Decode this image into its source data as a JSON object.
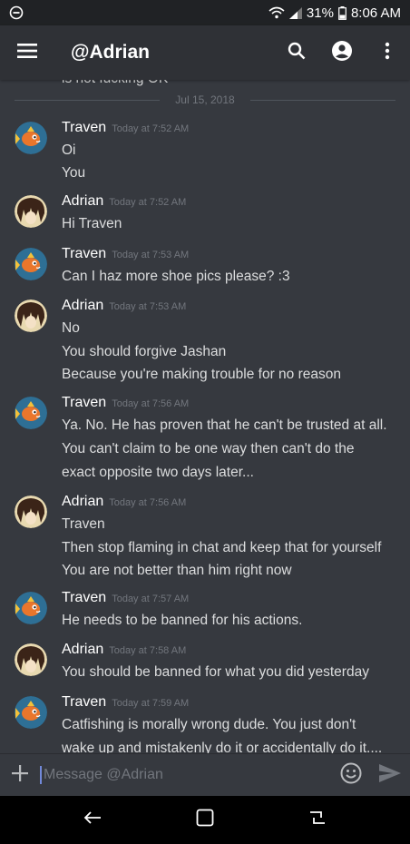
{
  "status_bar": {
    "battery": "31%",
    "time": "8:06 AM"
  },
  "app_bar": {
    "title": "@Adrian"
  },
  "chat": {
    "cut_off_text": "is not fucking OK",
    "date_divider": "Jul 15, 2018",
    "messages": [
      {
        "author": "Traven",
        "timestamp": "Today at 7:52 AM",
        "avatar": "magikarp-avatar",
        "lines": [
          "Oi",
          "You"
        ]
      },
      {
        "author": "Adrian",
        "timestamp": "Today at 7:52 AM",
        "avatar": "anime-character-avatar",
        "lines": [
          "Hi Traven"
        ]
      },
      {
        "author": "Traven",
        "timestamp": "Today at 7:53 AM",
        "avatar": "magikarp-avatar",
        "lines": [
          "Can I haz more shoe pics please? :3"
        ]
      },
      {
        "author": "Adrian",
        "timestamp": "Today at 7:53 AM",
        "avatar": "anime-character-avatar",
        "lines": [
          "No",
          "You should forgive Jashan",
          "Because you're making trouble for no reason"
        ]
      },
      {
        "author": "Traven",
        "timestamp": "Today at 7:56 AM",
        "avatar": "magikarp-avatar",
        "lines": [
          "Ya. No. He has proven that he can't be trusted at all.",
          "You can't claim to be one way then can't do the",
          "exact opposite two days later..."
        ]
      },
      {
        "author": "Adrian",
        "timestamp": "Today at 7:56 AM",
        "avatar": "anime-character-avatar",
        "lines": [
          "Traven",
          "Then stop flaming in chat and keep that for yourself",
          "You are not better than him right now"
        ]
      },
      {
        "author": "Traven",
        "timestamp": "Today at 7:57 AM",
        "avatar": "magikarp-avatar",
        "lines": [
          "He needs to be banned for his actions."
        ]
      },
      {
        "author": "Adrian",
        "timestamp": "Today at 7:58 AM",
        "avatar": "anime-character-avatar",
        "lines": [
          "You should be banned for what you did yesterday"
        ]
      },
      {
        "author": "Traven",
        "timestamp": "Today at 7:59 AM",
        "avatar": "magikarp-avatar",
        "lines": [
          "Catfishing is morally wrong dude. You just don't",
          "wake up and mistakenly do it or accidentally do it...."
        ]
      }
    ]
  },
  "composer": {
    "placeholder": "Message @Adrian"
  },
  "colors": {
    "background": "#36393f",
    "header": "#2f3136",
    "status_bar": "#202225",
    "accent": "#7289da"
  }
}
